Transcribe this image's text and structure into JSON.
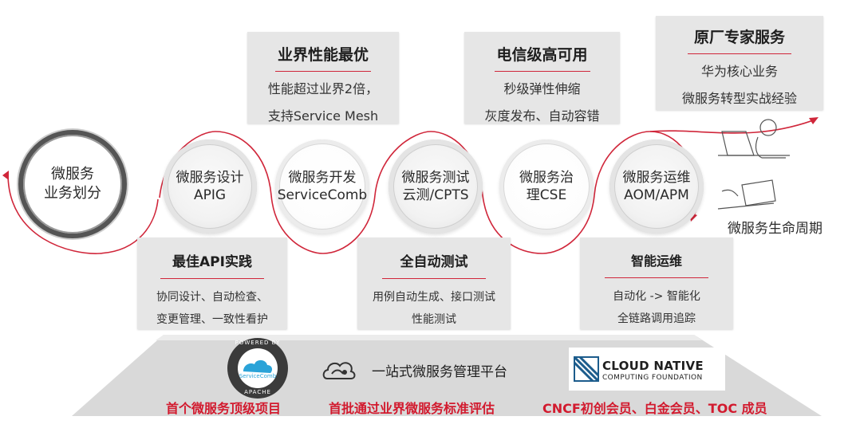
{
  "boxes_top": [
    {
      "title": "业界性能最优",
      "lines": [
        "性能超过业界2倍，",
        "支持Service Mesh"
      ]
    },
    {
      "title": "电信级高可用",
      "lines": [
        "秒级弹性伸缩",
        "灰度发布、自动容错"
      ]
    },
    {
      "title": "原厂专家服务",
      "lines": [
        "华为核心业务",
        "微服务转型实战经验"
      ]
    }
  ],
  "boxes_bottom": [
    {
      "title": "最佳API实践",
      "lines": [
        "协同设计、自动检查、",
        "变更管理、一致性看护"
      ]
    },
    {
      "title": "全自动测试",
      "lines": [
        "用例自动生成、接口测试",
        "性能测试"
      ]
    },
    {
      "title": "智能运维",
      "lines": [
        "自动化 -> 智能化",
        "全链路调用追踪"
      ]
    }
  ],
  "nodes": [
    {
      "lines": [
        "微服务",
        "业务划分"
      ]
    },
    {
      "lines": [
        "微服务设计",
        "APIG"
      ]
    },
    {
      "lines": [
        "微服务开发",
        "ServiceComb"
      ]
    },
    {
      "lines": [
        "微服务测试",
        "云测/CPTS"
      ]
    },
    {
      "lines": [
        "微服务治",
        "理CSE"
      ]
    },
    {
      "lines": [
        "微服务运维",
        "AOM/APM"
      ]
    }
  ],
  "lifecycle_label": "微服务生命周期",
  "platform": {
    "center_label": "一站式微服务管理平台",
    "badges": [
      "首个微服务顶级项目",
      "首批通过业界微服务标准评估",
      "CNCF初创会员、白金会员、TOC 成员"
    ],
    "apache_badge": {
      "ring_top": "POWERED BY",
      "ring_bottom": "APACHE",
      "center": "ServiceComb"
    },
    "cncf_logo": {
      "line1": "CLOUD NATIVE",
      "line2": "COMPUTING FOUNDATION"
    }
  },
  "colors": {
    "accent": "#d0263a",
    "box_bg": "#e6e6e6",
    "platform": "#d9d9d9"
  }
}
